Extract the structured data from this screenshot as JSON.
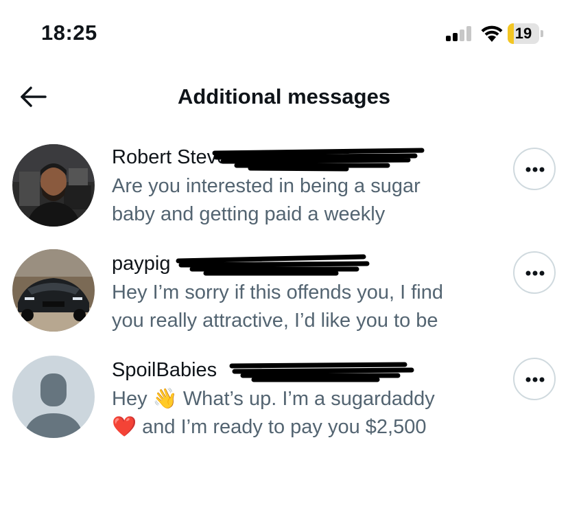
{
  "status_bar": {
    "time": "18:25",
    "battery_level": "19",
    "battery_color": "#f3c623",
    "signal_icon": "cellular-signal-icon",
    "wifi_icon": "wifi-icon"
  },
  "header": {
    "back_icon": "arrow-left-icon",
    "title": "Additional messages"
  },
  "messages": [
    {
      "name": "Robert Steve",
      "preview_line1": "Are you interested in being a sugar",
      "preview_line2": "baby and getting paid a weekly",
      "avatar": "profile-photo"
    },
    {
      "name": "paypig",
      "preview_line1": "Hey I’m sorry if this offends you, I find",
      "preview_line2": "you really attractive, I’d like you to be",
      "avatar": "car-photo"
    },
    {
      "name": "SpoilBabies",
      "preview_line1_a": "Hey",
      "preview_line1_emoji": "👋",
      "preview_line1_b": "What’s up. I’m a sugardaddy",
      "preview_line2_emoji": "❤️",
      "preview_line2": "and I’m ready to pay you $2,500",
      "avatar": "default-avatar"
    }
  ],
  "colors": {
    "text_primary": "#0f1419",
    "text_secondary": "#536471",
    "border": "#cfd9de",
    "default_avatar_bg": "#ccd6dd",
    "default_avatar_fg": "#66757f"
  }
}
